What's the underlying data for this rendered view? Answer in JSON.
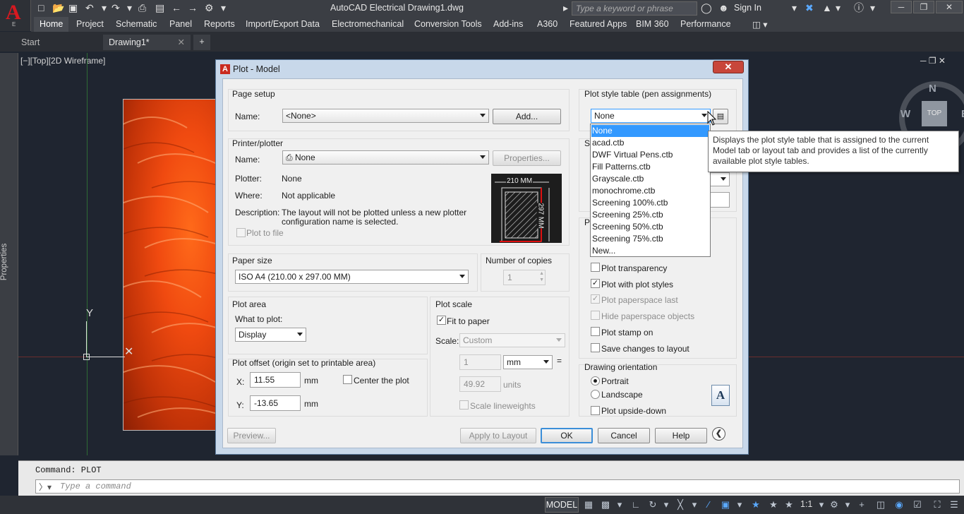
{
  "app": {
    "title": "AutoCAD Electrical   Drawing1.dwg",
    "logo_letter": "A",
    "logo_sub": "E",
    "search_placeholder": "Type a keyword or phrase",
    "sign_in": "Sign In"
  },
  "ribbon": {
    "tabs": [
      "Home",
      "Project",
      "Schematic",
      "Panel",
      "Reports",
      "Import/Export Data",
      "Electromechanical",
      "Conversion Tools",
      "Add-ins",
      "A360",
      "Featured Apps",
      "BIM 360",
      "Performance"
    ]
  },
  "doc_tabs": {
    "start": "Start",
    "drawing": "Drawing1*"
  },
  "viewport": {
    "label": "[−][Top][2D Wireframe]",
    "palette_label": "Properties",
    "ucs_y": "Y",
    "viewcube": {
      "n": "N",
      "w": "W",
      "e": "E",
      "top": "TOP"
    }
  },
  "dialog": {
    "title": "Plot - Model",
    "page_setup": {
      "title": "Page setup",
      "name_label": "Name:",
      "name_value": "<None>",
      "add_button": "Add..."
    },
    "printer": {
      "title": "Printer/plotter",
      "name_label": "Name:",
      "name_value": "None",
      "properties_button": "Properties...",
      "plotter_label": "Plotter:",
      "plotter_value": "None",
      "where_label": "Where:",
      "where_value": "Not applicable",
      "description_label": "Description:",
      "description_line1": "The layout will not be plotted unless a new plotter",
      "description_line2": "configuration name is selected.",
      "plot_to_file": "Plot to file",
      "preview_width": "210  MM",
      "preview_height": "297 MM"
    },
    "paper_size": {
      "title": "Paper size",
      "value": "ISO A4 (210.00 x 297.00 MM)"
    },
    "copies": {
      "title": "Number of copies",
      "value": "1"
    },
    "plot_area": {
      "title": "Plot area",
      "what_label": "What to plot:",
      "what_value": "Display"
    },
    "plot_offset": {
      "title": "Plot offset (origin set to printable area)",
      "x_label": "X:",
      "x_value": "11.55",
      "x_unit": "mm",
      "y_label": "Y:",
      "y_value": "-13.65",
      "y_unit": "mm",
      "center": "Center the plot"
    },
    "plot_scale": {
      "title": "Plot scale",
      "fit": "Fit to paper",
      "scale_label": "Scale:",
      "scale_value": "Custom",
      "value1": "1",
      "unit1": "mm",
      "equals": "=",
      "value2": "49.92",
      "unit2": "units",
      "lineweights": "Scale lineweights"
    },
    "style_table": {
      "title": "Plot style table (pen assignments)",
      "value": "None",
      "options": [
        "None",
        "acad.ctb",
        "DWF Virtual Pens.ctb",
        "Fill Patterns.ctb",
        "Grayscale.ctb",
        "monochrome.ctb",
        "Screening 100%.ctb",
        "Screening 25%.ctb",
        "Screening 50%.ctb",
        "Screening 75%.ctb",
        "New..."
      ],
      "hidden_label_prefix": "Sh",
      "hidden_group_prefix": "Pl"
    },
    "plot_options": {
      "transparency": "Plot transparency",
      "with_styles": "Plot with plot styles",
      "paperspace_last": "Plot paperspace last",
      "hide_paperspace": "Hide paperspace objects",
      "stamp": "Plot stamp on",
      "save_changes": "Save changes to layout"
    },
    "orientation": {
      "title": "Drawing orientation",
      "portrait": "Portrait",
      "landscape": "Landscape",
      "upside_down": "Plot upside-down",
      "icon_letter": "A"
    },
    "buttons": {
      "preview": "Preview...",
      "apply": "Apply to Layout",
      "ok": "OK",
      "cancel": "Cancel",
      "help": "Help"
    },
    "tooltip": "Displays the plot style table that is assigned to the current Model tab or layout tab and provides a list of the currently available plot style tables."
  },
  "command": {
    "history": "Command: PLOT",
    "placeholder": "Type a command"
  },
  "status": {
    "model": "MODEL",
    "scale": "1:1"
  }
}
